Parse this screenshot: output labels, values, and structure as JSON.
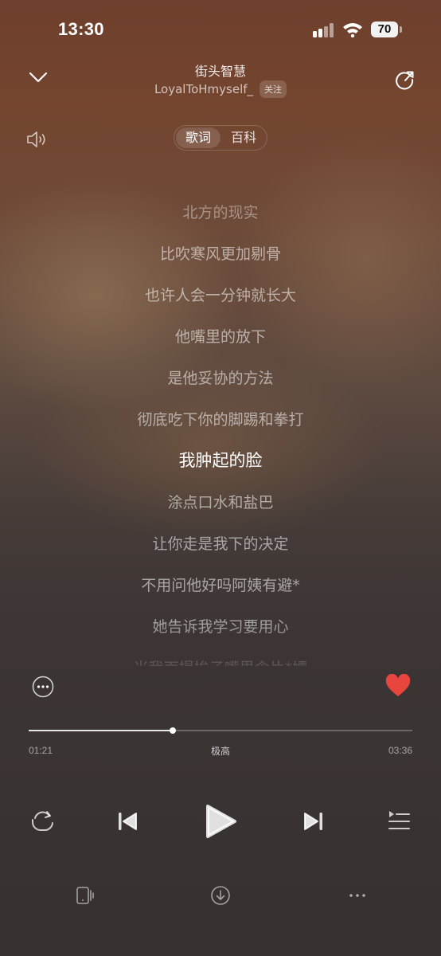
{
  "status_bar": {
    "time": "13:30",
    "battery": "70"
  },
  "header": {
    "song_title": "街头智慧",
    "artist": "LoyalToHmyself_",
    "follow_label": "关注"
  },
  "tabs": {
    "lyrics": "歌词",
    "wiki": "百科",
    "active": "歌词"
  },
  "lyrics": [
    "北方的现实",
    "比吹寒风更加剔骨",
    "也许人会一分钟就长大",
    "他嘴里的放下",
    "是他妥协的方法",
    "彻底吃下你的脚踢和拳打",
    "我肿起的脸",
    "涂点口水和盐巴",
    "让你走是我下的决定",
    "不用问他好吗阿姨有避*",
    "她告诉我学习要用心",
    "当我面提挨子嘴里含片*嫖"
  ],
  "active_lyric_index": 6,
  "player": {
    "current_time": "01:21",
    "total_time": "03:36",
    "quality": "极高",
    "progress": 0.375,
    "liked": true
  },
  "colors": {
    "heart": "#e9453f",
    "background_top": "#6e3f2c",
    "background_bottom": "#363130"
  },
  "icons": [
    "chevron-down-icon",
    "share-icon",
    "speaker-icon",
    "more-circle-icon",
    "heart-icon",
    "repeat-icon",
    "previous-icon",
    "play-icon",
    "next-icon",
    "playlist-icon",
    "device-icon",
    "download-icon",
    "more-dots-icon"
  ]
}
